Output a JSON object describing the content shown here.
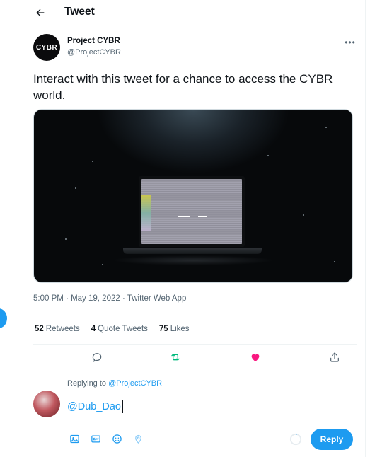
{
  "header": {
    "title": "Tweet",
    "back_icon": "arrow-left-icon"
  },
  "tweet": {
    "author_name": "Project CYBR",
    "author_handle": "@ProjectCYBR",
    "avatar_text": "CYBR",
    "text": "Interact with this tweet for a chance to access the CYBR world.",
    "time": "5:00 PM",
    "date": "May 19, 2022",
    "source": "Twitter Web App",
    "separator": "·"
  },
  "stats": {
    "retweets_count": "52",
    "retweets_label": "Retweets",
    "quotes_count": "4",
    "quotes_label": "Quote Tweets",
    "likes_count": "75",
    "likes_label": "Likes"
  },
  "actions": [
    {
      "name": "reply-icon",
      "color": "#536471"
    },
    {
      "name": "retweet-icon",
      "color": "#00ba7c"
    },
    {
      "name": "like-icon",
      "color": "#f91880"
    },
    {
      "name": "share-icon",
      "color": "#536471"
    }
  ],
  "reply": {
    "replying_prefix": "Replying to",
    "replying_mention": "@ProjectCYBR",
    "input_value": "@Dub_Dao",
    "button_label": "Reply"
  },
  "colors": {
    "accent": "#1d9bf0",
    "text": "#0f1419",
    "muted": "#536471",
    "like": "#f91880",
    "retweet": "#00ba7c"
  }
}
